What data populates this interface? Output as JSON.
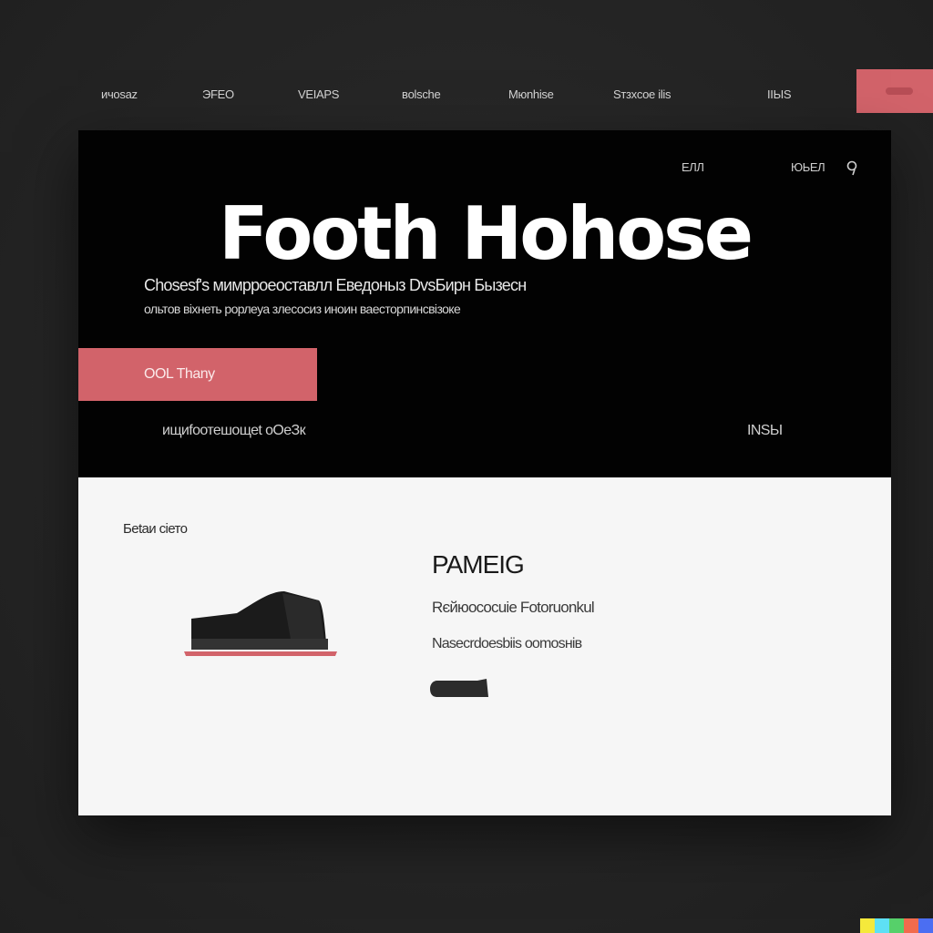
{
  "topnav": {
    "items": [
      {
        "label": "ичоsaz"
      },
      {
        "label": "ЭFEO"
      },
      {
        "label": "VEIAPS"
      },
      {
        "label": "вolsche"
      },
      {
        "label": "Mюnhise"
      },
      {
        "label": "Sтзxcoe ilis"
      },
      {
        "label": "IIЫS"
      }
    ],
    "cta_color": "#d2636a"
  },
  "hero": {
    "links": [
      {
        "label": "ЕЛЛ"
      },
      {
        "label": "ЮЬЕЛ"
      }
    ],
    "icon": "search-icon",
    "title": "Footh Hohose",
    "subtitle_line1": "Chosesf's мимрроеоставлл Еведоныз DvsБирн Бызесн",
    "subtitle_line2": "ольтов віхнеть рорлеуа злесосиз иноин ваесторпинсвізоке",
    "button_label": "ООL Тhany",
    "footer_left": "ищиfоотешощеt оОеЗк",
    "footer_right": "INSЫ"
  },
  "product": {
    "label": "Беtаи сiето",
    "name": "PAMEIG",
    "desc_line1": "Rєйюocоcuie Fotoruonkul",
    "desc_line2": "Nasecrdoesbiis oomosнів",
    "image": "sneaker-image",
    "accent_color": "#d2636a"
  },
  "colors": {
    "background": "#262626",
    "hero_bg": "#020202",
    "panel_bg": "#f6f6f6",
    "accent": "#d2636a"
  }
}
